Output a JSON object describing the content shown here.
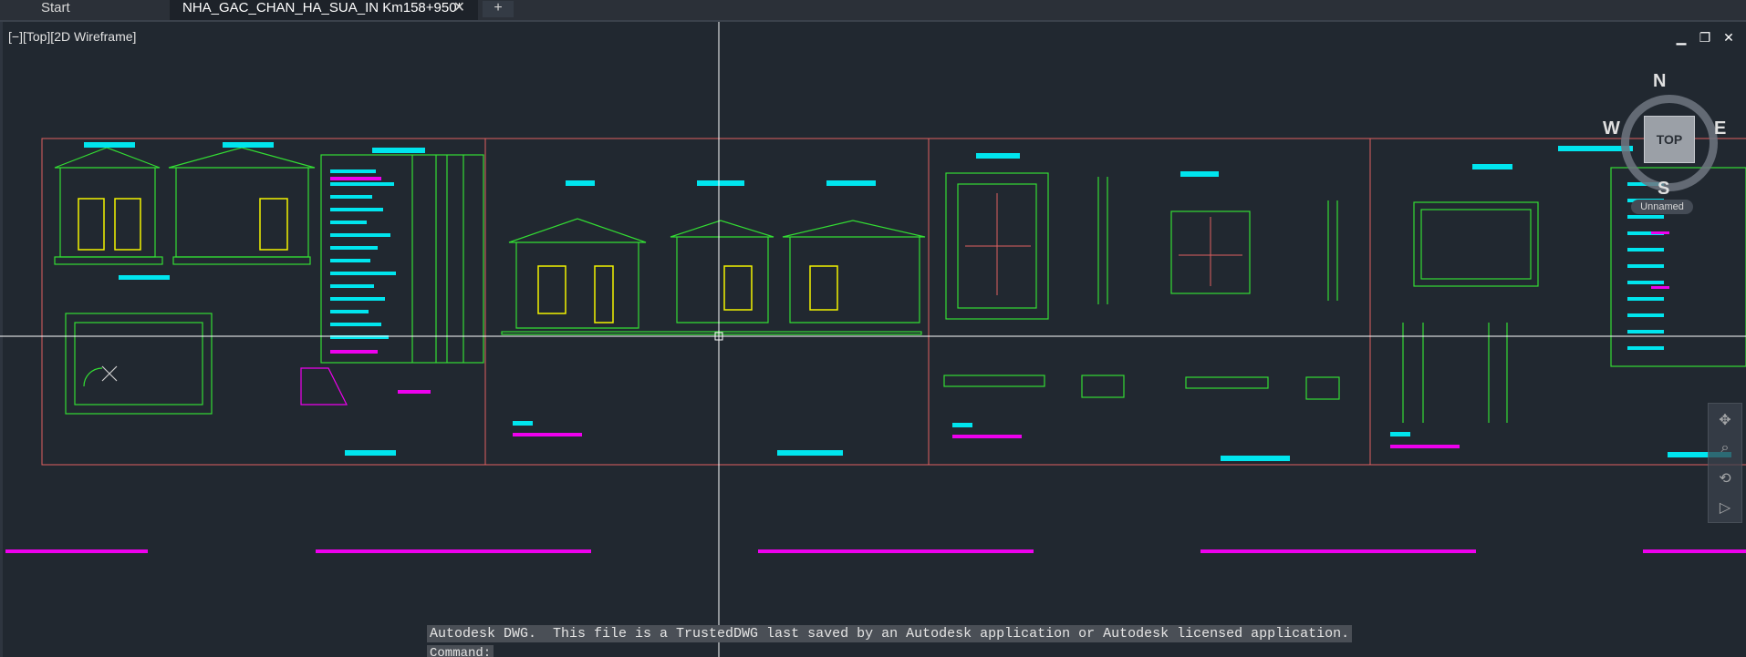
{
  "tabs": {
    "start_label": "Start",
    "drawing_label": "NHA_GAC_CHAN_HA_SUA_IN Km158+950*",
    "close_glyph": "✕",
    "add_glyph": "+"
  },
  "viewport": {
    "label": "[−][Top][2D Wireframe]",
    "minimize_glyph": "▁",
    "restore_glyph": "❐",
    "close_glyph": "✕"
  },
  "viewcube": {
    "top_face": "TOP",
    "north": "N",
    "south": "S",
    "east": "E",
    "west": "W",
    "wcs_menu": "Unnamed"
  },
  "command": {
    "history": "Autodesk DWG.  This file is a TrustedDWG last saved by an Autodesk application or Autodesk licensed application.",
    "prompt": "Command:"
  },
  "colors": {
    "background": "#212830",
    "border_red": "#e06060",
    "green": "#33dd33",
    "cyan": "#00e5ee",
    "magenta": "#ee00ee",
    "yellow": "#f2f200",
    "white": "#ffffff"
  }
}
